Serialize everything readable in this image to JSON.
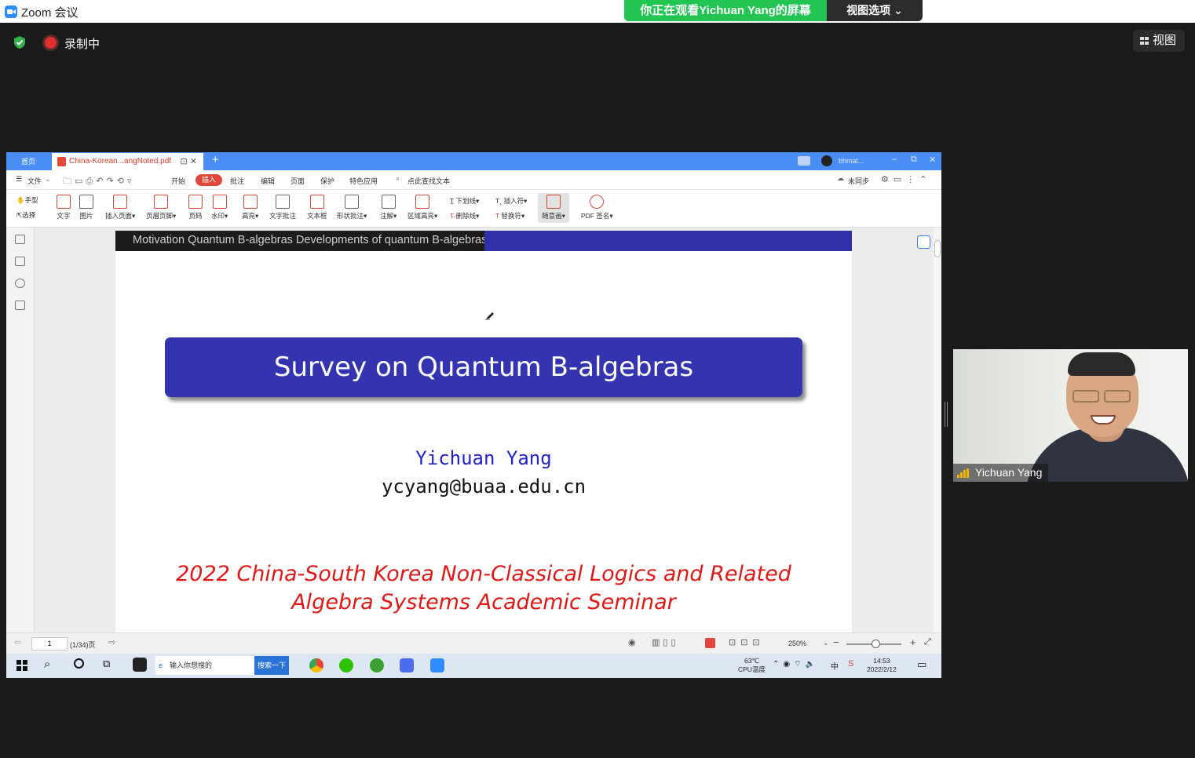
{
  "zoom": {
    "app_icon": "zoom-camera-icon",
    "title": "Zoom 会议",
    "share_banner": "你正在观看Yichuan  Yang的屏幕",
    "view_options": "视图选项",
    "recording": "录制中",
    "view_button": "视图"
  },
  "wps": {
    "tabs": {
      "home": "首页",
      "file": "China-Korean...angNoted.pdf",
      "add": "+",
      "user": "bhmat..."
    },
    "menu": {
      "file": "文件",
      "start": "开始",
      "insert": "插入",
      "annotate": "批注",
      "edit": "编辑",
      "page": "页面",
      "protect": "保护",
      "features": "特色应用",
      "search": "点此查找文本",
      "sync": "未同步"
    },
    "ribbon": {
      "hand": "手型",
      "select": "选择",
      "text": "文字",
      "image": "图片",
      "insert_page": "插入页面",
      "header_footer": "页眉页脚",
      "page_num": "页码",
      "watermark": "水印",
      "highlight": "高亮",
      "text_note": "文字批注",
      "textbox": "文本框",
      "shape_note": "形状批注",
      "comment": "注解",
      "area_highlight": "区域高亮",
      "underline": "下划线",
      "strikethrough": "删除线",
      "insert_mark": "插入符",
      "replace_mark": "替换符",
      "freehand": "随意画",
      "pdf_sign": "PDF 签名"
    },
    "status": {
      "page": "1",
      "page_count": "(1/34)页",
      "zoom": "250%"
    }
  },
  "slide": {
    "nav": "Motivation   Quantum B-algebras   Developments of quantum B-algebras",
    "title": "Survey on Quantum B-algebras",
    "author": "Yichuan Yang",
    "email": "ycyang@buaa.edu.cn",
    "seminar_line1": "2022 China-South Korea Non-Classical Logics and Related",
    "seminar_line2": "Algebra Systems Academic Seminar"
  },
  "taskbar": {
    "search_placeholder": "输入你想搜的",
    "search_button": "搜索一下",
    "temp": "63℃",
    "temp_label": "CPU温度",
    "ime": "中",
    "time": "14:53",
    "date": "2022/2/12"
  },
  "video": {
    "participant": "Yichuan Yang"
  }
}
